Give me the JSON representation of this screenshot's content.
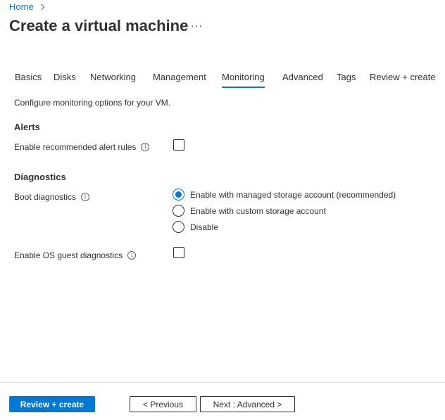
{
  "breadcrumb": {
    "home": "Home"
  },
  "page": {
    "title": "Create a virtual machine",
    "more": "···"
  },
  "tabs": [
    {
      "label": "Basics"
    },
    {
      "label": "Disks"
    },
    {
      "label": "Networking"
    },
    {
      "label": "Management"
    },
    {
      "label": "Monitoring",
      "active": true
    },
    {
      "label": "Advanced"
    },
    {
      "label": "Tags"
    },
    {
      "label": "Review + create"
    }
  ],
  "description": "Configure monitoring options for your VM.",
  "alerts": {
    "heading": "Alerts",
    "recommended_rules": {
      "label": "Enable recommended alert rules",
      "checked": false
    }
  },
  "diagnostics": {
    "heading": "Diagnostics",
    "boot": {
      "label": "Boot diagnostics",
      "options": [
        {
          "label": "Enable with managed storage account (recommended)",
          "selected": true
        },
        {
          "label": "Enable with custom storage account",
          "selected": false
        },
        {
          "label": "Disable",
          "selected": false
        }
      ]
    },
    "os_guest": {
      "label": "Enable OS guest diagnostics",
      "checked": false
    }
  },
  "footer": {
    "review_create": "Review + create",
    "previous": "< Previous",
    "next": "Next : Advanced >"
  },
  "colors": {
    "accent": "#0078d4",
    "text": "#323130",
    "border": "#e1dfdd"
  }
}
